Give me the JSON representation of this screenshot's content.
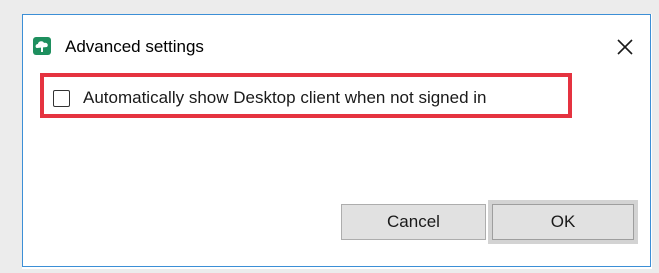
{
  "dialog": {
    "title": "Advanced settings",
    "app_icon": "cloud-leaf-icon",
    "close_icon": "close-icon"
  },
  "option": {
    "label": "Automatically show Desktop client when not signed in",
    "checked": false
  },
  "buttons": {
    "cancel_label": "Cancel",
    "ok_label": "OK"
  },
  "colors": {
    "highlight": "#e53340",
    "dialog_border": "#3c8fd6",
    "icon_bg": "#1e8f5e",
    "button_bg": "#e1e1e1"
  }
}
